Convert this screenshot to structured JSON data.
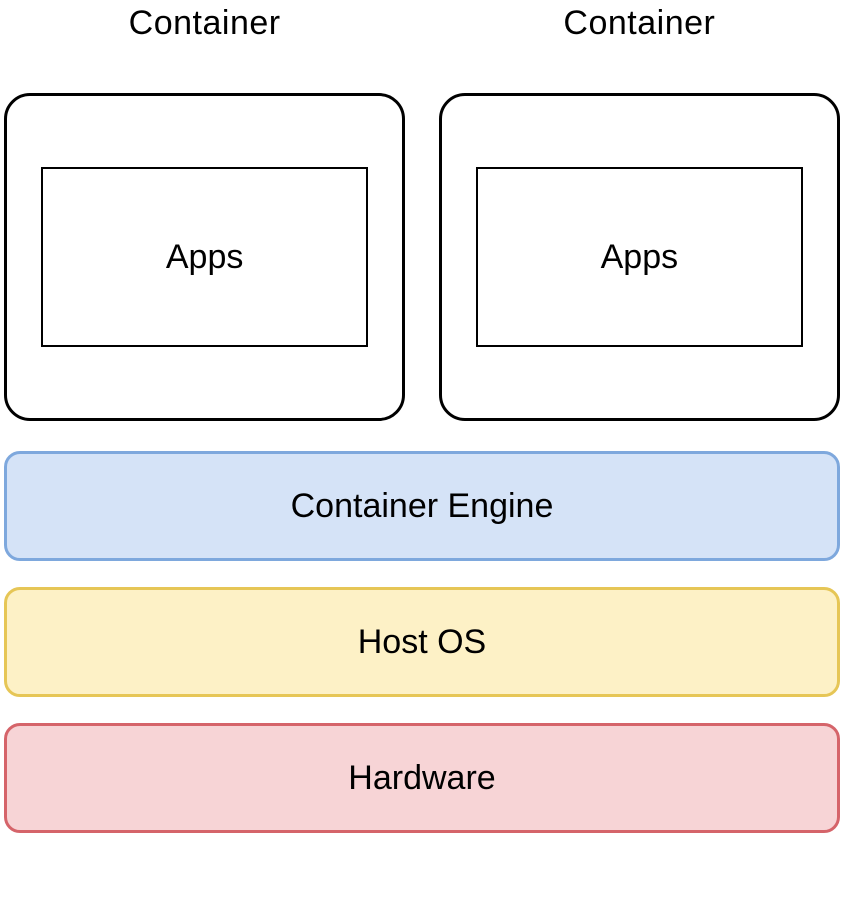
{
  "diagram": {
    "containers": [
      {
        "label": "Container",
        "apps_label": "Apps"
      },
      {
        "label": "Container",
        "apps_label": "Apps"
      }
    ],
    "layers": {
      "engine": "Container Engine",
      "hostos": "Host OS",
      "hardware": "Hardware"
    },
    "colors": {
      "engine_fill": "#d5e3f7",
      "engine_border": "#7ea8dd",
      "hostos_fill": "#fdf1c6",
      "hostos_border": "#e6c656",
      "hardware_fill": "#f7d4d6",
      "hardware_border": "#d5646a"
    }
  }
}
